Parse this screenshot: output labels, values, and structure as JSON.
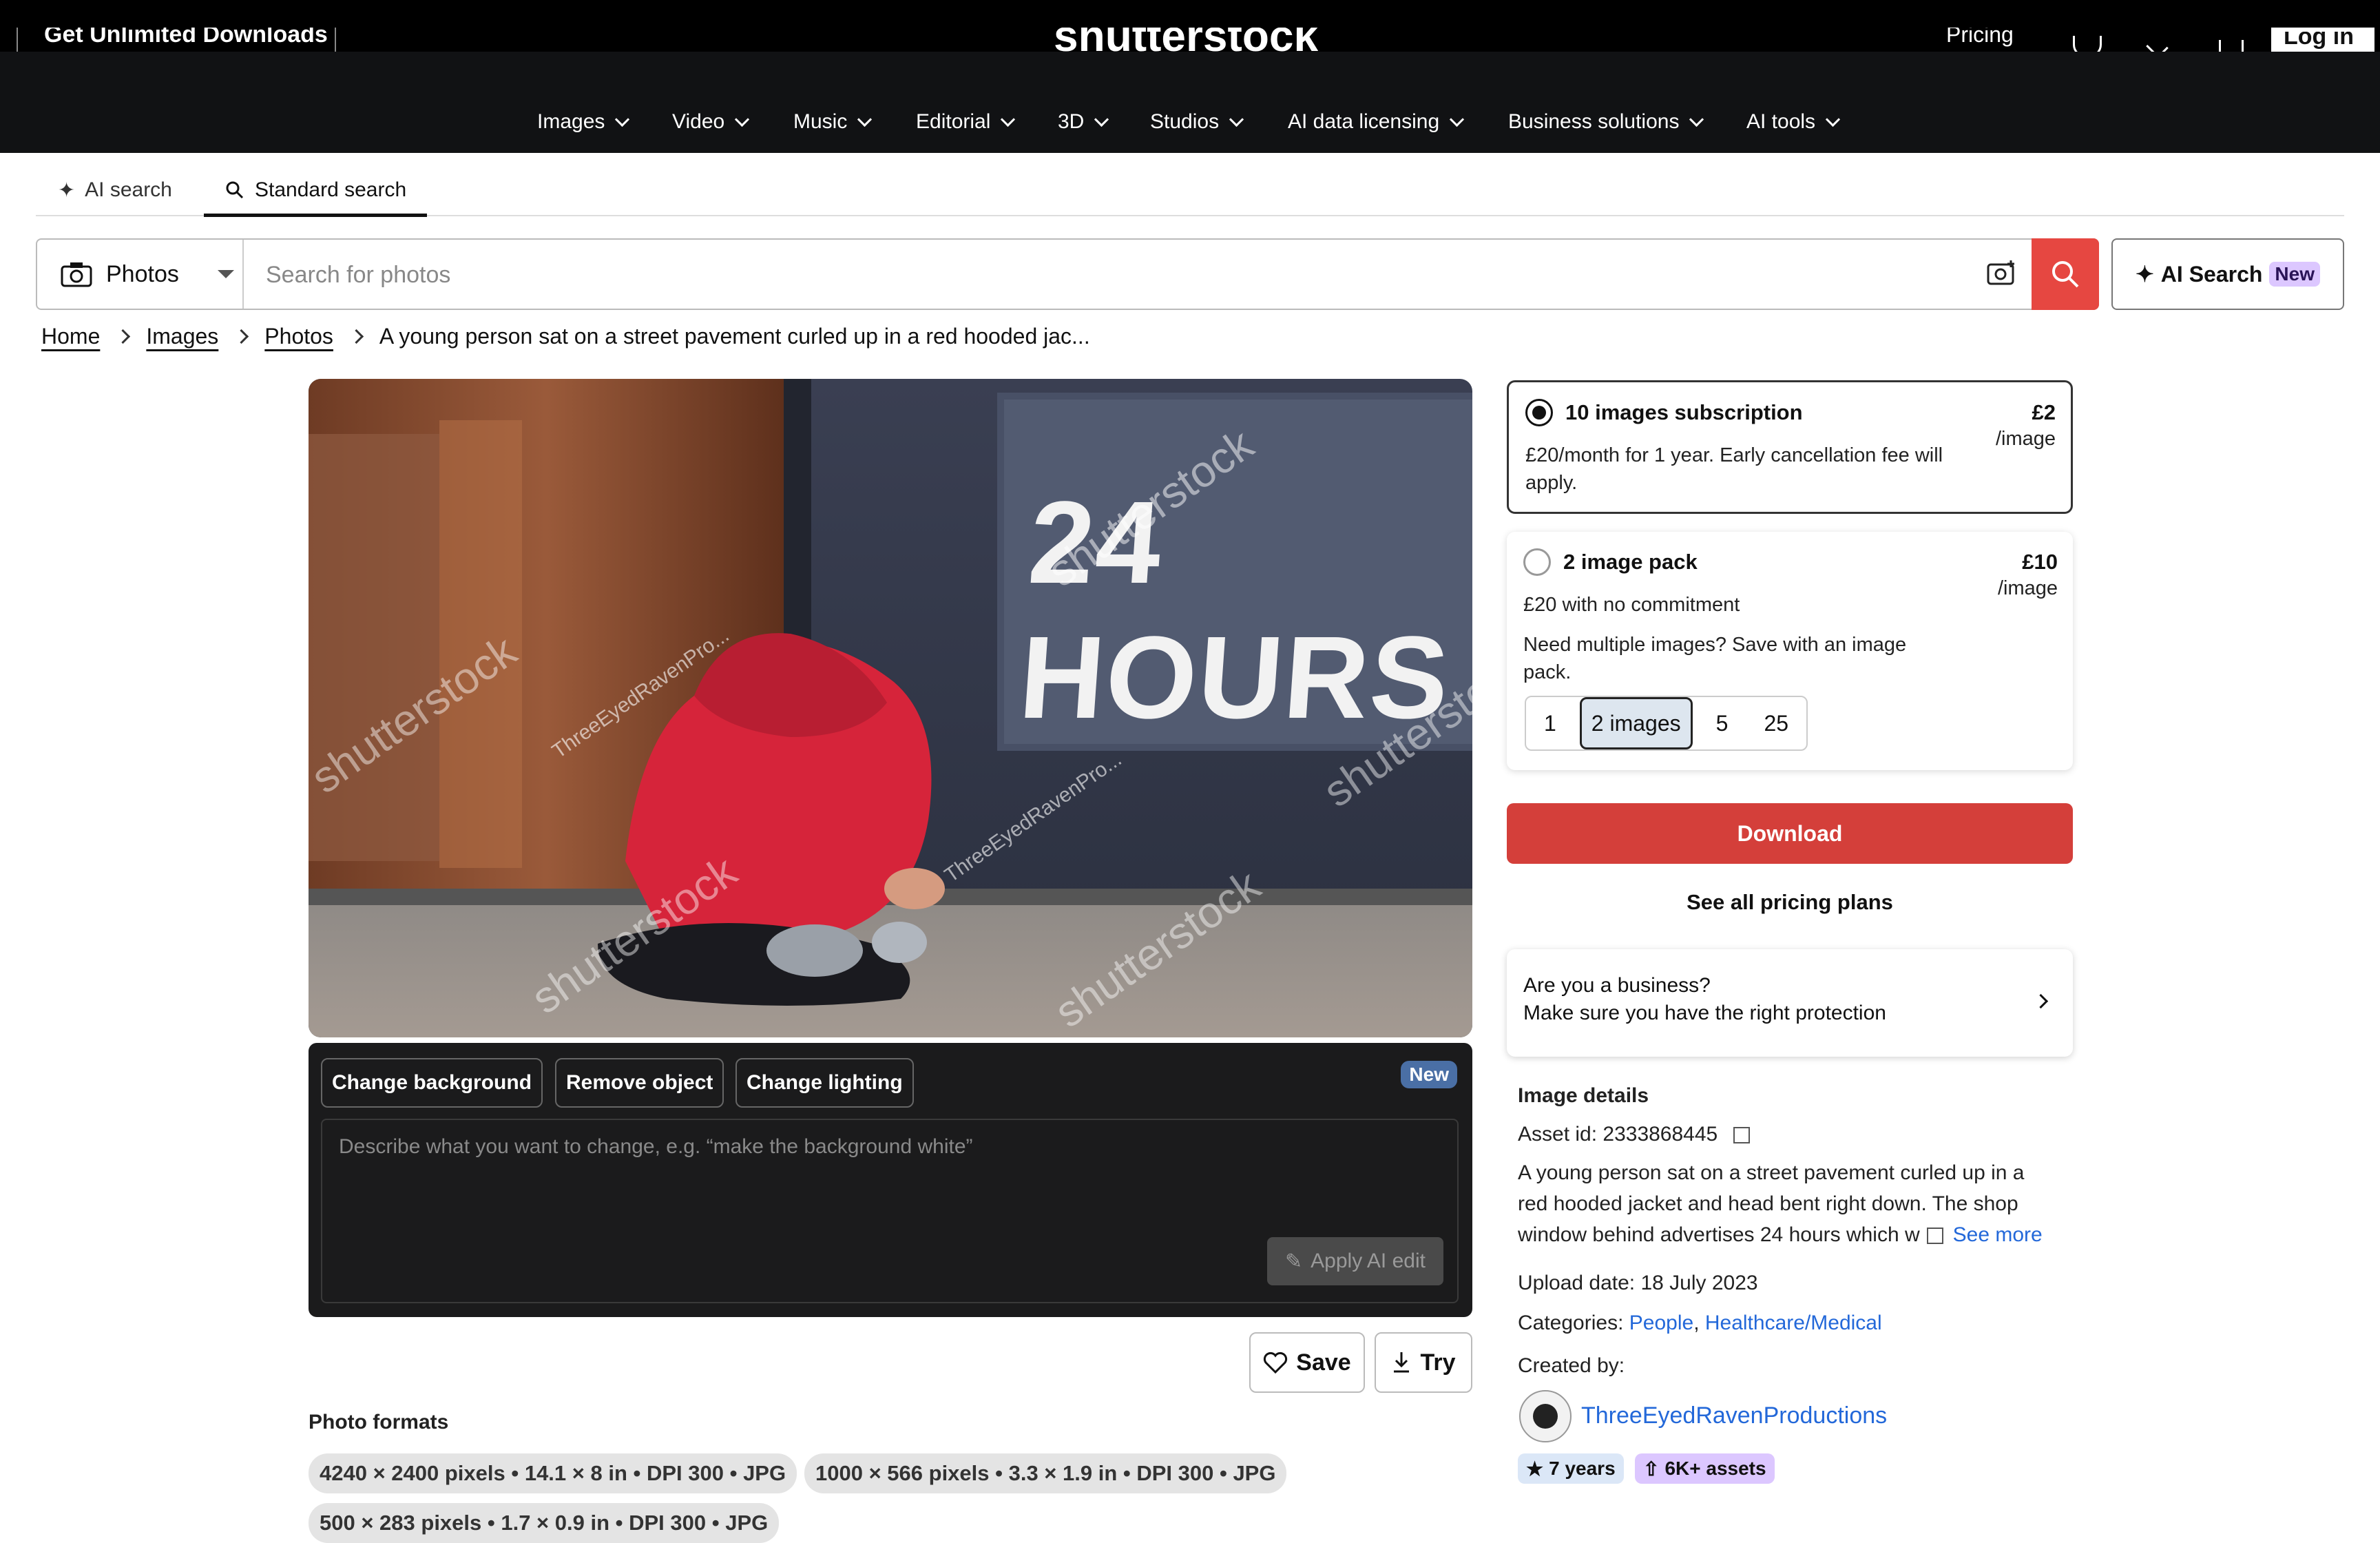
{
  "colors": {
    "accent_red": "#e64741",
    "download_red": "#d43f3a",
    "link_blue": "#2368d9",
    "new_purple": "#dcc7ff"
  },
  "header": {
    "get_unlimited": "Get Unlimited Downloads",
    "logo": "shutterstock",
    "pricing": "Pricing",
    "login": "Log in",
    "nav": [
      "Images",
      "Video",
      "Music",
      "Editorial",
      "3D",
      "Studios",
      "AI data licensing",
      "Business solutions",
      "AI tools"
    ]
  },
  "search_tabs": {
    "ai": "AI search",
    "standard": "Standard search"
  },
  "search": {
    "type": "Photos",
    "placeholder": "Search for photos",
    "ai_button": "AI Search",
    "ai_new": "New"
  },
  "breadcrumb": [
    "Home",
    "Images",
    "Photos",
    "A young person sat on a street pavement curled up in a red hooded jac..."
  ],
  "photo": {
    "window_text": "24 HOURS",
    "watermark": "shutterstock",
    "contributor_mark": "ThreeEyedRavenPro..."
  },
  "ai_edit": {
    "chips": [
      "Change background",
      "Remove object",
      "Change lighting"
    ],
    "new_badge": "New",
    "placeholder": "Describe what you want to change, e.g. “make the background white”",
    "apply": "Apply AI edit"
  },
  "actions": {
    "save": "Save",
    "try": "Try"
  },
  "formats": {
    "title": "Photo formats",
    "items": [
      "4240 × 2400 pixels • 14.1 × 8 in • DPI 300 • JPG",
      "1000 × 566 pixels • 3.3 × 1.9 in • DPI 300 • JPG",
      "500 × 283 pixels • 1.7 × 0.9 in • DPI 300 • JPG"
    ]
  },
  "pricing": {
    "subscription": {
      "title": "10 images subscription",
      "price": "£2",
      "per": "/image",
      "desc_line1": "£20/month for 1 year. Early cancellation fee will",
      "desc_line2": "apply."
    },
    "pack": {
      "title": "2 image pack",
      "price": "£10",
      "per": "/image",
      "desc": "£20 with no commitment",
      "tip_line1": "Need multiple images? Save with an image",
      "tip_line2": "pack.",
      "options": [
        "1",
        "2 images",
        "5",
        "25"
      ]
    },
    "download": "Download",
    "see_all": "See all pricing plans"
  },
  "business": {
    "line1": "Are you a business?",
    "line2": "Make sure you have the right protection"
  },
  "details": {
    "title": "Image details",
    "asset_id": "Asset id: 2333868445",
    "desc_line1": "A young person sat on a street pavement curled up in a",
    "desc_line2": "red hooded jacket and head bent right down. The shop",
    "desc_line3": "window behind advertises 24 hours which w",
    "see_more": "See more",
    "upload_date": "Upload date: 18 July 2023",
    "categories_label": "Categories:",
    "categories": [
      "People",
      "Healthcare/Medical"
    ],
    "created_by": "Created by:",
    "creator": "ThreeEyedRavenProductions",
    "years": "7 years",
    "assets": "6K+ assets"
  }
}
